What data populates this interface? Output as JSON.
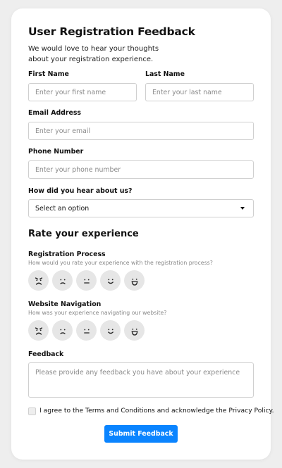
{
  "form": {
    "title": "User Registration Feedback",
    "subtitle": "We would love to hear your thoughts about your registration experience.",
    "first_name": {
      "label": "First Name",
      "placeholder": "Enter your first name"
    },
    "last_name": {
      "label": "Last Name",
      "placeholder": "Enter your last name"
    },
    "email": {
      "label": "Email Address",
      "placeholder": "Enter your email"
    },
    "phone": {
      "label": "Phone Number",
      "placeholder": "Enter your phone number"
    },
    "source": {
      "label": "How did you hear about us?",
      "selected": "Select an option"
    },
    "rate_heading": "Rate your experience",
    "ratings": [
      {
        "label": "Registration Process",
        "hint": "How would you rate your experience with the registration process?",
        "faces": [
          "very-dissatisfied-face-icon",
          "dissatisfied-face-icon",
          "neutral-face-icon",
          "satisfied-face-icon",
          "very-satisfied-face-icon"
        ]
      },
      {
        "label": "Website Navigation",
        "hint": "How was your experience navigating our website?",
        "faces": [
          "very-dissatisfied-face-icon",
          "dissatisfied-face-icon",
          "neutral-face-icon",
          "satisfied-face-icon",
          "very-satisfied-face-icon"
        ]
      }
    ],
    "feedback": {
      "label": "Feedback",
      "placeholder": "Please provide any feedback you have about your experience"
    },
    "terms_text": "I agree to the Terms and Conditions and acknowledge the Privacy Policy.",
    "submit_label": "Submit Feedback"
  },
  "colors": {
    "background": "#eeeeee",
    "card": "#ffffff",
    "accent": "#0a84ff",
    "face_fill": "#e6e6e6",
    "border": "#cfcfcf"
  }
}
